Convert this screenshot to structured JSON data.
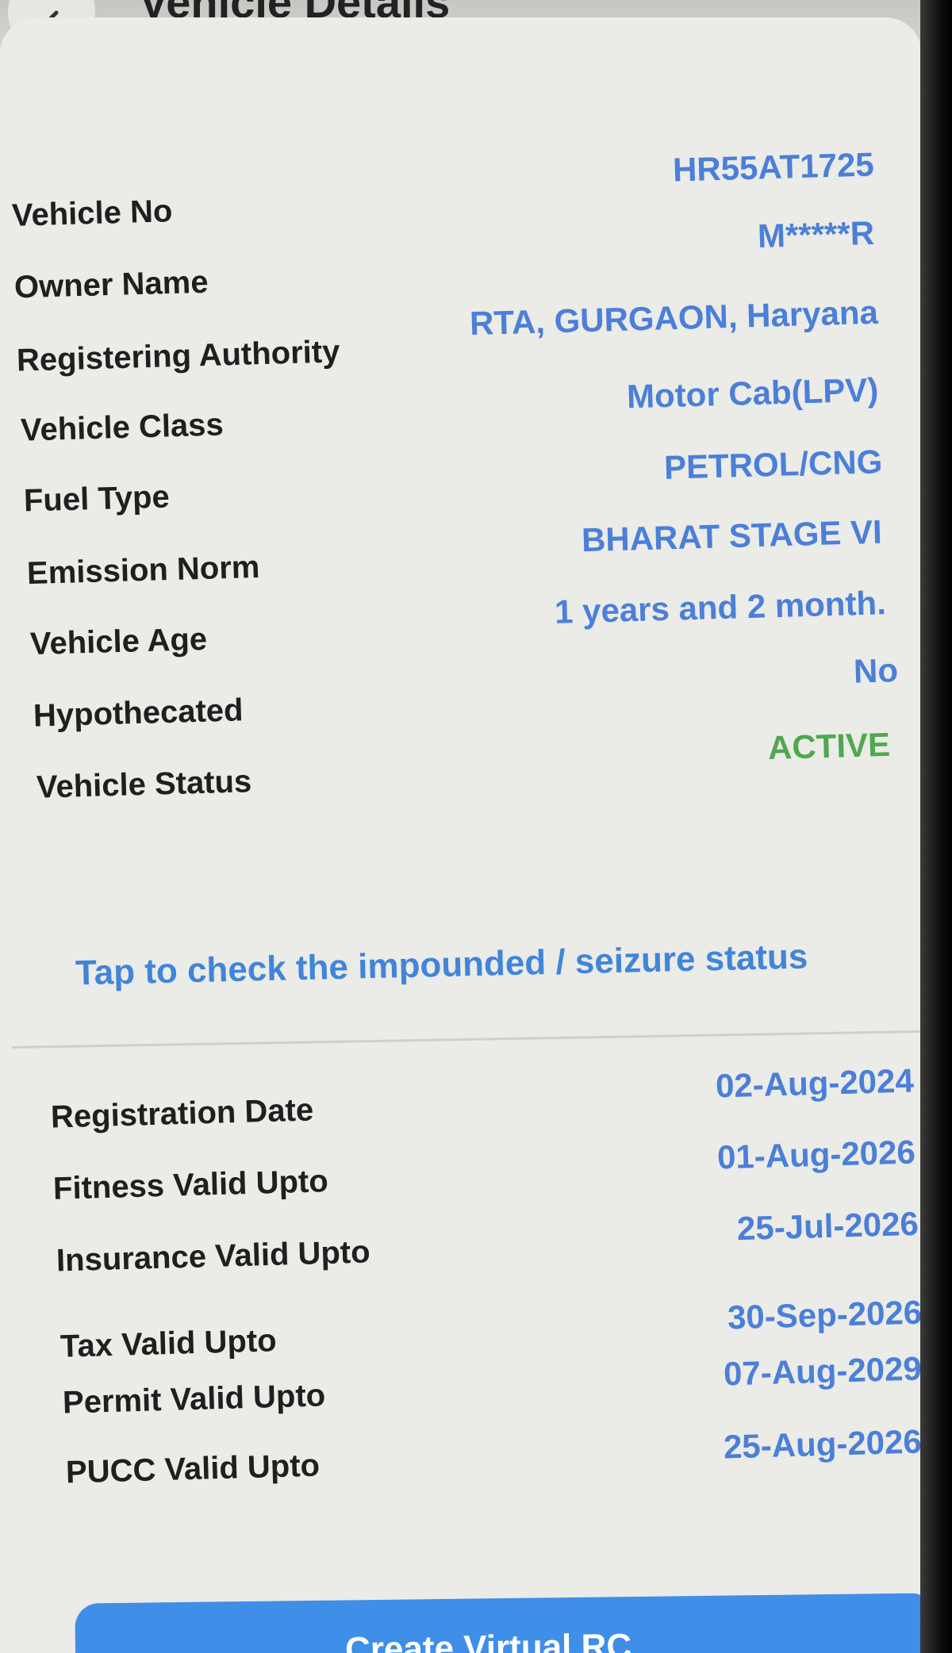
{
  "header": {
    "title": "Vehicle Details"
  },
  "vehicle_details": [
    {
      "label": "Vehicle No",
      "value": "HR55AT1725"
    },
    {
      "label": "Owner Name",
      "value": "M*****R"
    },
    {
      "label": "Registering Authority",
      "value": "RTA, GURGAON, Haryana"
    },
    {
      "label": "Vehicle Class",
      "value": "Motor Cab(LPV)"
    },
    {
      "label": "Fuel Type",
      "value": "PETROL/CNG"
    },
    {
      "label": "Emission Norm",
      "value": "BHARAT STAGE VI"
    },
    {
      "label": "Vehicle Age",
      "value": "1 years and 2 month."
    },
    {
      "label": "Hypothecated",
      "value": "No"
    },
    {
      "label": "Vehicle Status",
      "value": "ACTIVE"
    }
  ],
  "seizure_link": "Tap to check the impounded / seizure status",
  "validity_details": [
    {
      "label": "Registration Date",
      "value": "02-Aug-2024"
    },
    {
      "label": "Fitness Valid Upto",
      "value": "01-Aug-2026"
    },
    {
      "label": "Insurance Valid Upto",
      "value": "25-Jul-2026"
    },
    {
      "label": "Tax Valid Upto",
      "value": "30-Sep-2026"
    },
    {
      "label": "Permit Valid Upto",
      "value": "07-Aug-2029"
    },
    {
      "label": "PUCC Valid Upto",
      "value": "25-Aug-2026"
    }
  ],
  "primary_button_label": "Create Virtual RC",
  "colors": {
    "value_blue": "#4b7fd8",
    "status_green": "#4fa84f",
    "link_blue": "#4185d9",
    "button_blue": "#3f8ee8"
  }
}
